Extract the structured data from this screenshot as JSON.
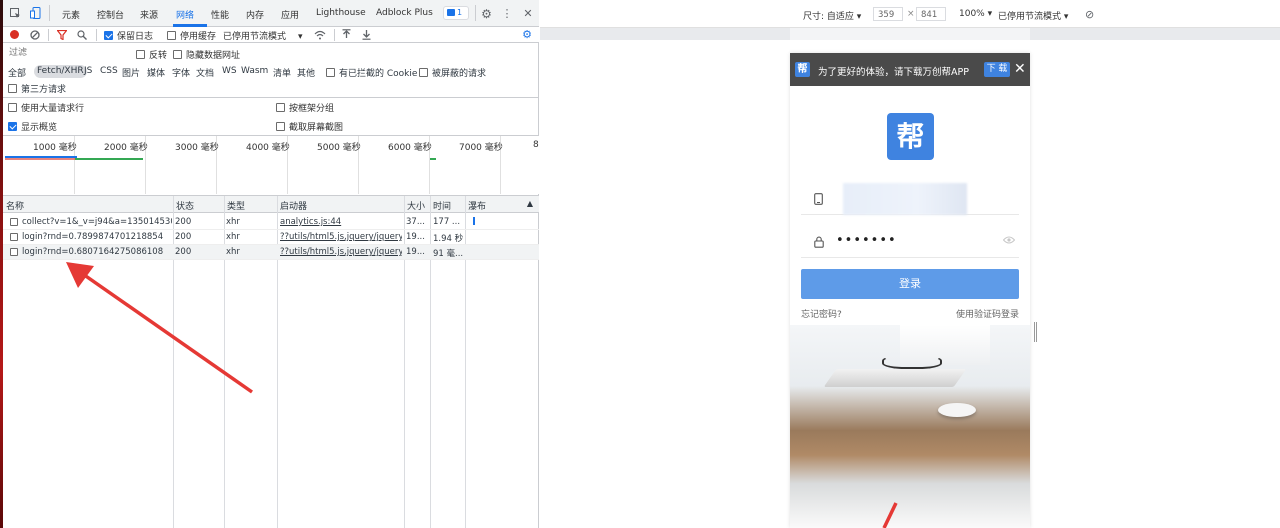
{
  "devtools": {
    "tabs": [
      "元素",
      "控制台",
      "来源",
      "网络",
      "性能",
      "内存",
      "应用",
      "Lighthouse",
      "Adblock Plus"
    ],
    "active_tab": "网络",
    "issues_badge": "1",
    "toolbar": {
      "preserve_log": "保留日志",
      "disable_cache": "停用缓存",
      "throttling": "已停用节流模式"
    },
    "filter": {
      "placeholder": "过滤",
      "invert": "反转",
      "hide_data_urls": "隐藏数据网址"
    },
    "types": [
      "全部",
      "Fetch/XHR",
      "JS",
      "CSS",
      "图片",
      "媒体",
      "字体",
      "文档",
      "WS",
      "Wasm",
      "清单",
      "其他"
    ],
    "selected_type": "Fetch/XHR",
    "blocked_cookies": "有已拦截的 Cookie",
    "blocked_requests": "被屏蔽的请求",
    "third_party": "第三方请求",
    "options": {
      "large_rows": "使用大量请求行",
      "group_by_frame": "按框架分组",
      "show_overview": "显示概览",
      "capture_screenshots": "截取屏幕截图"
    },
    "overview_labels": [
      "1000 毫秒",
      "2000 毫秒",
      "3000 毫秒",
      "4000 毫秒",
      "5000 毫秒",
      "6000 毫秒",
      "7000 毫秒",
      "8"
    ],
    "columns": [
      "名称",
      "状态",
      "类型",
      "启动器",
      "大小",
      "时间",
      "瀑布"
    ],
    "rows": [
      {
        "name": "collect?v=1&_v=j94&a=1350145301...",
        "status": "200",
        "type": "xhr",
        "initiator": "analytics.js:44",
        "size": "37...",
        "time": "177 ..."
      },
      {
        "name": "login?rnd=0.7899874701218854",
        "status": "200",
        "type": "xhr",
        "initiator": "??utils/html5.js,jquery/jquery...",
        "size": "19...",
        "time": "1.94 秒"
      },
      {
        "name": "login?rnd=0.6807164275086108",
        "status": "200",
        "type": "xhr",
        "initiator": "??utils/html5.js,jquery/jquery...",
        "size": "19...",
        "time": "91 毫..."
      }
    ]
  },
  "device_toolbar": {
    "dimensions_label": "尺寸: 自适应",
    "width": "359",
    "height": "841",
    "zoom": "100%",
    "throttling": "已停用节流模式"
  },
  "mobile": {
    "banner_text": "为了更好的体验，请下载万创帮APP",
    "banner_logo": "帮",
    "download_label": "下 载",
    "app_logo": "帮",
    "password_mask": "•••••••",
    "login_label": "登录",
    "forgot_password": "忘记密码?",
    "sms_login": "使用验证码登录"
  },
  "colors": {
    "accent": "#1a73e8",
    "record_red": "#d93025",
    "brand_blue": "#3f83e0",
    "login_button": "#5e9be8",
    "annotation_arrow": "#e53935"
  }
}
